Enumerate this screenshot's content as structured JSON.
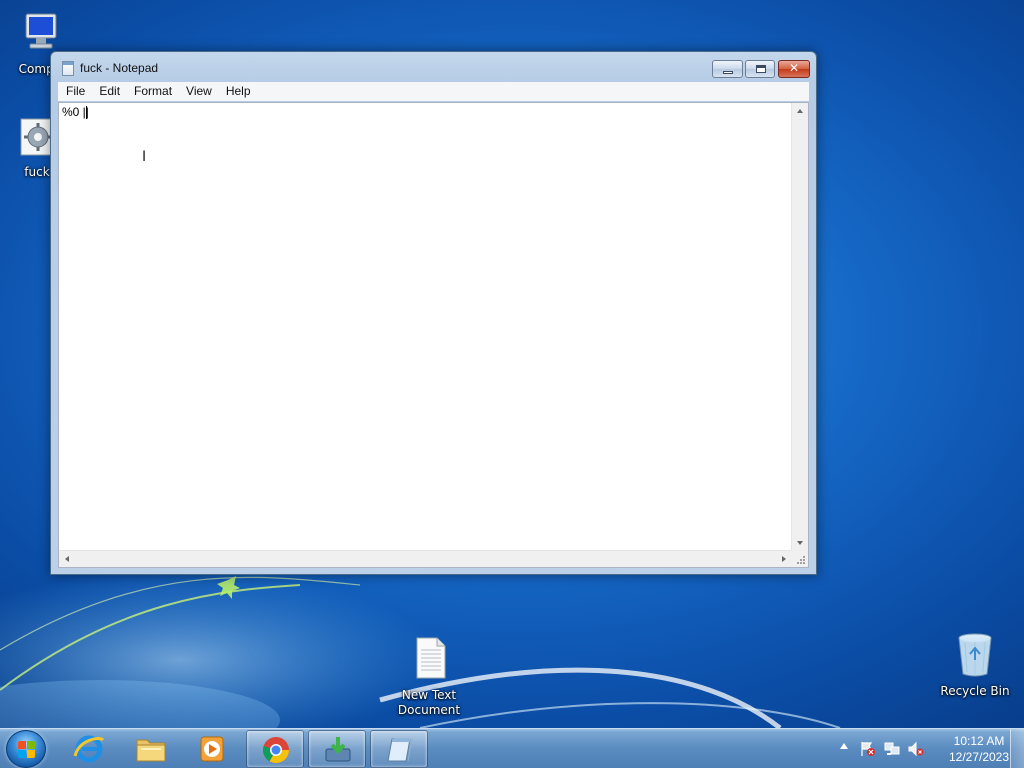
{
  "desktop": {
    "icons": [
      {
        "label": "Compu",
        "icon": "computer-icon"
      },
      {
        "label": "fuck",
        "icon": "settings-file-icon"
      },
      {
        "label_line1": "New Text",
        "label_line2": "Document",
        "icon": "text-document-icon"
      },
      {
        "label": "Recycle Bin",
        "icon": "recycle-bin-icon"
      }
    ]
  },
  "window": {
    "title": "fuck - Notepad",
    "buttons": {
      "minimize": "minimize",
      "maximize": "maximize",
      "close": "✕"
    },
    "menu": [
      "File",
      "Edit",
      "Format",
      "View",
      "Help"
    ],
    "content": "%0 ||"
  },
  "taskbar": {
    "pinned": [
      "internet-explorer-icon",
      "file-explorer-icon",
      "media-player-icon",
      "chrome-icon",
      "downloads-icon",
      "notepad-icon"
    ],
    "active": "notepad-icon",
    "clock": {
      "time": "10:12 AM",
      "date": "12/27/2023"
    }
  },
  "colors": {
    "accent": "#1566c4",
    "title_bar": "#bcd0e8",
    "close_button": "#c23a1a"
  }
}
